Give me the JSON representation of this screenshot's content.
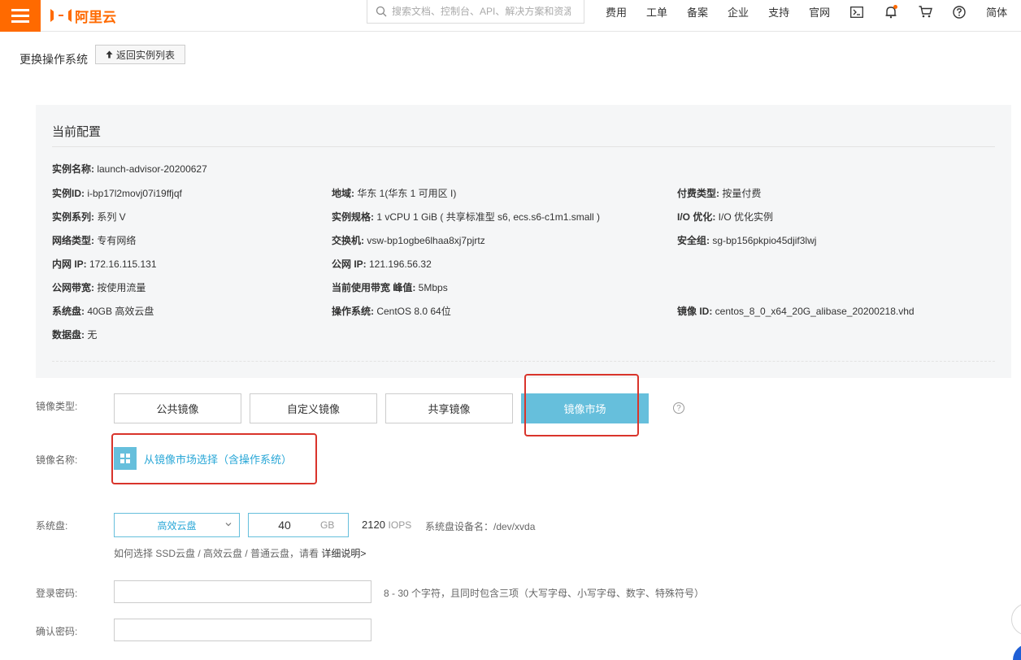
{
  "header": {
    "logo_text": "阿里云",
    "search_placeholder": "搜索文档、控制台、API、解决方案和资源",
    "nav": [
      "费用",
      "工单",
      "备案",
      "企业",
      "支持",
      "官网"
    ],
    "lang": "简体",
    "icons": [
      "menu-icon",
      "terminal-icon",
      "bell-icon",
      "cart-icon",
      "help-icon"
    ]
  },
  "page": {
    "title": "更换操作系统",
    "back_label": "返回实例列表"
  },
  "config": {
    "title": "当前配置",
    "instance_name": {
      "k": "实例名称:",
      "v": " launch-advisor-20200627"
    },
    "instance_id": {
      "k": "实例ID:",
      "v": " i-bp17l2movj07i19ffjqf"
    },
    "region": {
      "k": "地域:",
      "v": " 华东 1(华东 1 可用区 I)"
    },
    "billing": {
      "k": "付费类型:",
      "v": " 按量付费"
    },
    "series": {
      "k": "实例系列:",
      "v": " 系列 V"
    },
    "spec": {
      "k": "实例规格:",
      "v": " 1 vCPU 1 GiB ( 共享标准型 s6, ecs.s6-c1m1.small )"
    },
    "io": {
      "k": "I/O 优化:",
      "v": " I/O 优化实例"
    },
    "network": {
      "k": "网络类型:",
      "v": " 专有网络"
    },
    "switch": {
      "k": "交换机:",
      "v": " vsw-bp1ogbe6lhaa8xj7pjrtz"
    },
    "security_group": {
      "k": "安全组:",
      "v": " sg-bp156pkpio45djif3lwj"
    },
    "private_ip": {
      "k": "内网 IP:",
      "v": " 172.16.115.131"
    },
    "public_ip": {
      "k": "公网 IP:",
      "v": " 121.196.56.32"
    },
    "bandwidth": {
      "k": "公网带宽:",
      "v": " 按使用流量"
    },
    "peak": {
      "k": "当前使用带宽 峰值:",
      "v": " 5Mbps"
    },
    "system_disk": {
      "k": "系统盘:",
      "v": " 40GB 高效云盘"
    },
    "os": {
      "k": "操作系统:",
      "v": " CentOS 8.0 64位"
    },
    "image_id": {
      "k": "镜像 ID:",
      "v": " centos_8_0_x64_20G_alibase_20200218.vhd"
    },
    "data_disk": {
      "k": "数据盘:",
      "v": " 无"
    }
  },
  "form": {
    "image_type_label": "镜像类型:",
    "image_tabs": [
      "公共镜像",
      "自定义镜像",
      "共享镜像",
      "镜像市场"
    ],
    "active_tab": "镜像市场",
    "image_name_label": "镜像名称:",
    "market_link": "从镜像市场选择（含操作系统）",
    "system_disk_label": "系统盘:",
    "disk_type": "高效云盘",
    "disk_size": "40",
    "disk_unit": "GB",
    "iops_value": "2120",
    "iops_unit": "IOPS",
    "device_name": "系统盘设备名：/dev/xvda",
    "hint_text": "如何选择 SSD云盘 / 高效云盘 / 普通云盘，请看 ",
    "hint_link": "详细说明>",
    "password_label": "登录密码:",
    "password_hint": "8 - 30 个字符，且同时包含三项（大写字母、小写字母、数字、特殊符号）",
    "confirm_label": "确认密码:"
  },
  "colors": {
    "brand": "#ff6a00",
    "accent": "#66bfdc",
    "link": "#29a7d7",
    "highlight": "#d9342b"
  }
}
